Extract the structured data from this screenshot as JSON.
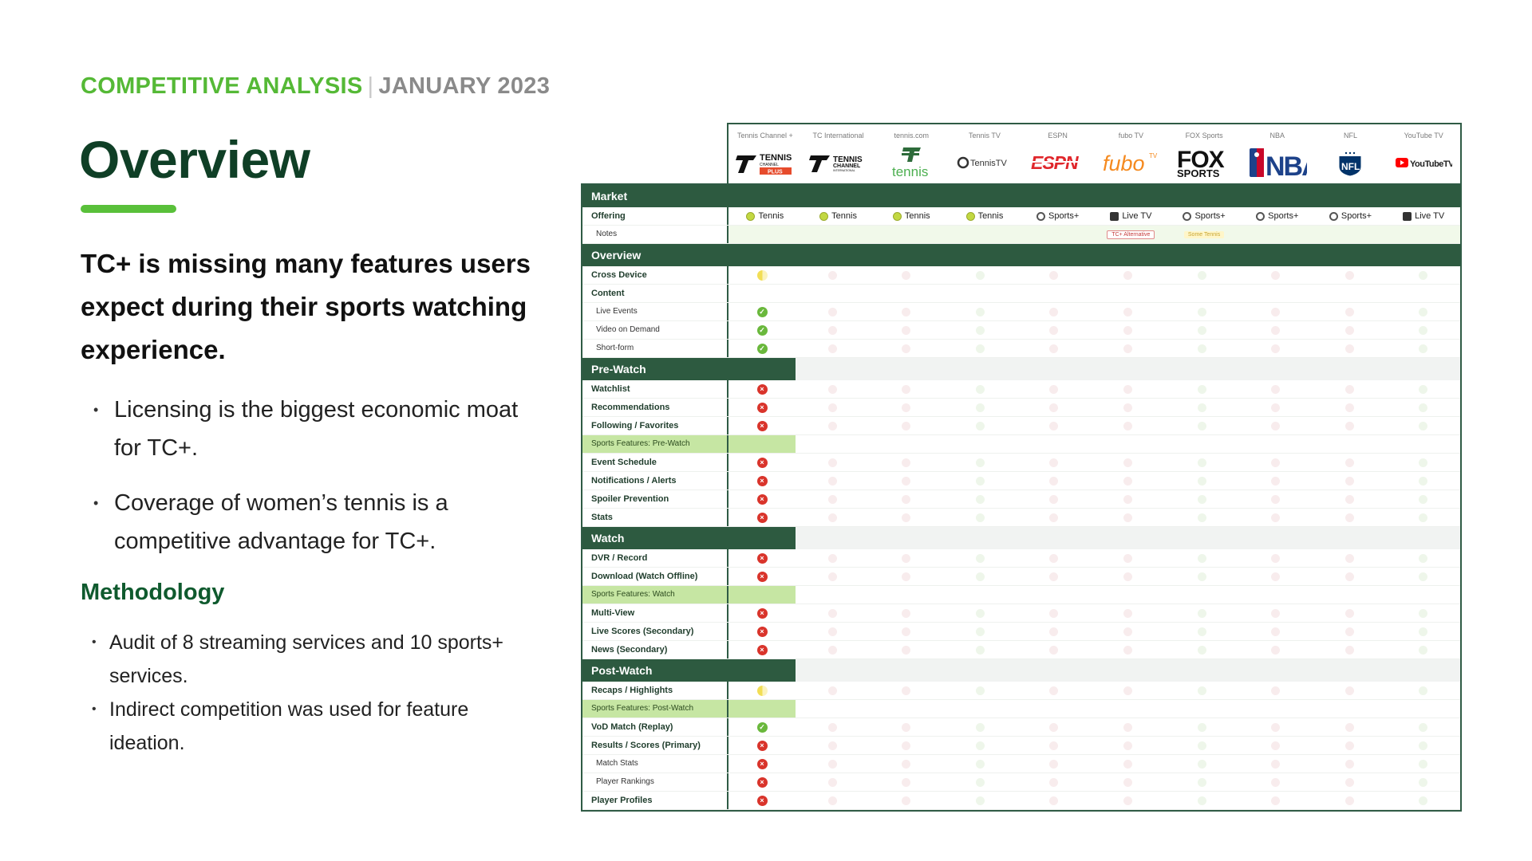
{
  "header": {
    "kicker_main": "COMPETITIVE ANALYSIS",
    "kicker_sep": "|",
    "kicker_date": "JANUARY 2023",
    "title": "Overview"
  },
  "lead": "TC+ is missing many features users expect during their sports watching experience.",
  "bullets": [
    "Licensing is the biggest economic moat for TC+.",
    "Coverage of women’s tennis is a competitive advantage for TC+."
  ],
  "methodology": {
    "title": "Methodology",
    "items": [
      "Audit of 8 streaming services and 10 sports+ services.",
      "Indirect competition was used for feature ideation."
    ]
  },
  "services": [
    {
      "name": "Tennis Channel +",
      "logo": "TENNIS CHANNEL PLUS",
      "offering": "Tennis",
      "offering_icon": "tennis-ball-icon",
      "note": ""
    },
    {
      "name": "TC International",
      "logo": "TENNIS CHANNEL INTERNATIONAL",
      "offering": "Tennis",
      "offering_icon": "tennis-ball-icon",
      "note": ""
    },
    {
      "name": "tennis.com",
      "logo": "tennis",
      "offering": "Tennis",
      "offering_icon": "tennis-ball-icon",
      "note": ""
    },
    {
      "name": "Tennis TV",
      "logo": "TennisTV",
      "offering": "Tennis",
      "offering_icon": "tennis-ball-icon",
      "note": ""
    },
    {
      "name": "ESPN",
      "logo": "ESPN",
      "offering": "Sports+",
      "offering_icon": "soccer-ball-icon",
      "note": ""
    },
    {
      "name": "fubo TV",
      "logo": "fubo",
      "offering": "Live TV",
      "offering_icon": "tv-icon",
      "note": "TC+ Alternative"
    },
    {
      "name": "FOX Sports",
      "logo": "FOX SPORTS",
      "offering": "Sports+",
      "offering_icon": "soccer-ball-icon",
      "note": "Some Tennis"
    },
    {
      "name": "NBA",
      "logo": "NBA",
      "offering": "Sports+",
      "offering_icon": "soccer-ball-icon",
      "note": ""
    },
    {
      "name": "NFL",
      "logo": "NFL",
      "offering": "Sports+",
      "offering_icon": "soccer-ball-icon",
      "note": ""
    },
    {
      "name": "YouTube TV",
      "logo": "YouTubeTV",
      "offering": "Live TV",
      "offering_icon": "tv-icon",
      "note": ""
    }
  ],
  "colors": {
    "accent_green": "#55b936",
    "dark_green": "#2d5a40",
    "yes": "#6ab83c",
    "no": "#d9342b",
    "partial": "#f2de55",
    "highlight": "#c6e6a3"
  },
  "rows": [
    {
      "kind": "category",
      "label": "Market"
    },
    {
      "kind": "offering",
      "label": "Offering"
    },
    {
      "kind": "notes",
      "label": "Notes"
    },
    {
      "kind": "category",
      "label": "Overview"
    },
    {
      "kind": "feature",
      "label": "Cross Device",
      "tc": "half"
    },
    {
      "kind": "feature",
      "label": "Content",
      "tc": ""
    },
    {
      "kind": "sub",
      "label": "Live Events",
      "tc": "yes"
    },
    {
      "kind": "sub",
      "label": "Video on Demand",
      "tc": "yes"
    },
    {
      "kind": "sub",
      "label": "Short-form",
      "tc": "yes"
    },
    {
      "kind": "category-partial",
      "label": "Pre-Watch"
    },
    {
      "kind": "feature",
      "label": "Watchlist",
      "tc": "no"
    },
    {
      "kind": "feature",
      "label": "Recommendations",
      "tc": "no"
    },
    {
      "kind": "feature",
      "label": "Following / Favorites",
      "tc": "no"
    },
    {
      "kind": "green",
      "label": "Sports Features: Pre-Watch"
    },
    {
      "kind": "feature",
      "label": "Event Schedule",
      "tc": "no"
    },
    {
      "kind": "feature",
      "label": "Notifications / Alerts",
      "tc": "no"
    },
    {
      "kind": "feature",
      "label": "Spoiler Prevention",
      "tc": "no"
    },
    {
      "kind": "feature",
      "label": "Stats",
      "tc": "no"
    },
    {
      "kind": "category-partial",
      "label": "Watch"
    },
    {
      "kind": "feature",
      "label": "DVR / Record",
      "tc": "no"
    },
    {
      "kind": "feature",
      "label": "Download (Watch Offline)",
      "tc": "no"
    },
    {
      "kind": "green",
      "label": "Sports Features: Watch"
    },
    {
      "kind": "feature",
      "label": "Multi-View",
      "tc": "no"
    },
    {
      "kind": "feature",
      "label": "Live Scores (Secondary)",
      "tc": "no"
    },
    {
      "kind": "feature",
      "label": "News (Secondary)",
      "tc": "no"
    },
    {
      "kind": "category-partial",
      "label": "Post-Watch"
    },
    {
      "kind": "feature",
      "label": "Recaps / Highlights",
      "tc": "half"
    },
    {
      "kind": "green",
      "label": "Sports Features: Post-Watch"
    },
    {
      "kind": "feature",
      "label": "VoD Match (Replay)",
      "tc": "yes"
    },
    {
      "kind": "feature",
      "label": "Results / Scores (Primary)",
      "tc": "no"
    },
    {
      "kind": "sub",
      "label": "Match Stats",
      "tc": "no"
    },
    {
      "kind": "sub",
      "label": "Player Rankings",
      "tc": "no"
    },
    {
      "kind": "feature",
      "label": "Player Profiles",
      "tc": "no"
    }
  ]
}
